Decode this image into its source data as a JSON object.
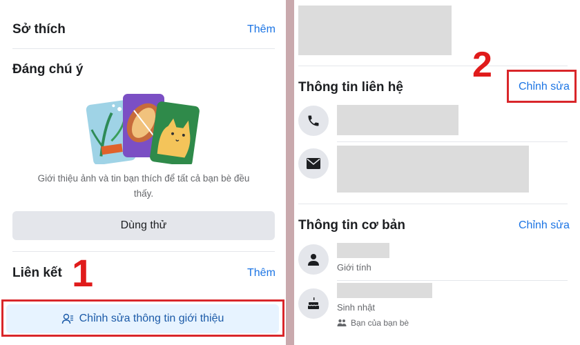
{
  "left": {
    "hobbies": {
      "title": "Sở thích",
      "action": "Thêm"
    },
    "featured": {
      "title": "Đáng chú ý",
      "description_line1": "Giới thiệu ảnh và tin bạn thích để tất cả bạn bè đều",
      "description_line2": "thấy.",
      "try_button": "Dùng thử"
    },
    "links": {
      "title": "Liên kết",
      "action": "Thêm"
    },
    "edit_intro_button": "Chỉnh sửa thông tin giới thiệu",
    "step_marker": "1"
  },
  "right": {
    "contact": {
      "title": "Thông tin liên hệ",
      "action": "Chỉnh sửa"
    },
    "basic": {
      "title": "Thông tin cơ bản",
      "action": "Chỉnh sửa",
      "gender_label": "Giới tính",
      "birthday_label": "Sinh nhật",
      "audience_label": "Bạn của bạn bè"
    },
    "step_marker": "2"
  },
  "colors": {
    "accent": "#1b74e4",
    "highlight": "#d9262a",
    "marker": "#e01b1b"
  }
}
